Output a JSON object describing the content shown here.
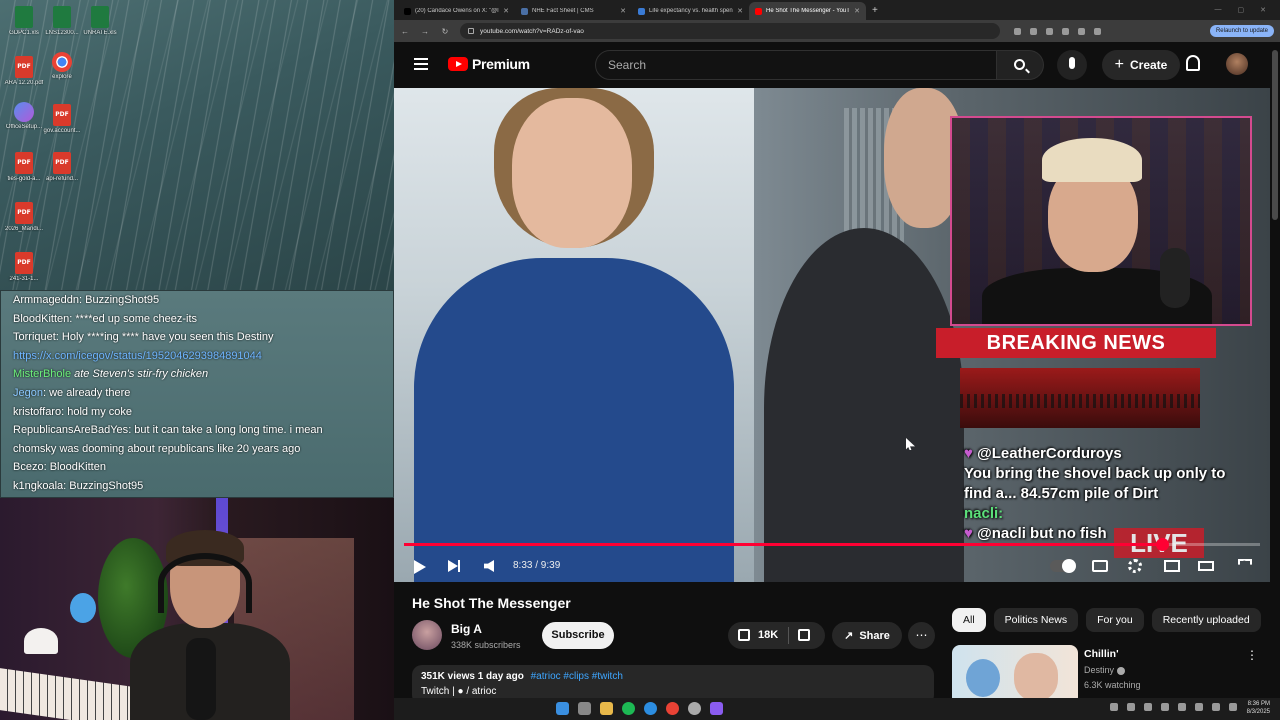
{
  "desktop": {
    "icons": [
      {
        "label": "GDPC1.xls",
        "type": "xls"
      },
      {
        "label": "LNS12300...",
        "type": "xls"
      },
      {
        "label": "UNRATE.xls",
        "type": "xls"
      },
      {
        "label": "ARA 12.20.pdf",
        "type": "pdf"
      },
      {
        "label": "explore",
        "type": "chrome"
      },
      {
        "label": "OfficeSetup...",
        "type": "office"
      },
      {
        "label": "gov.account...",
        "type": "pdf"
      },
      {
        "label": "ties-gold-a...",
        "type": "pdf"
      },
      {
        "label": "api-refund...",
        "type": "pdf"
      },
      {
        "label": "2026_Mandi...",
        "type": "pdf"
      },
      {
        "label": "241-31-1...",
        "type": "pdf"
      }
    ]
  },
  "chat": {
    "lines": [
      {
        "user": "Armmageddn",
        "text": ": BuzzingShot95"
      },
      {
        "user": "BloodKitten",
        "text": ": ****ed up some cheez-its"
      },
      {
        "user": "Torriquet",
        "text": ": Holy ****ing **** have you seen this Destiny"
      },
      {
        "user": "",
        "text": "https://x.com/icegov/status/1952046293984891044"
      },
      {
        "user": "MisterBhole",
        "text": " ate Steven's stir-fry chicken"
      },
      {
        "user": "Jegon",
        "text": ": we already there"
      },
      {
        "user": "kristoffaro",
        "text": ": hold my coke"
      },
      {
        "user": "RepublicansAreBadYes",
        "text": ": but it can take a long long time. i mean"
      },
      {
        "user": "",
        "text": "chomsky was dooming about republicans like 20 years ago"
      },
      {
        "user": "Bcezo",
        "text": ": BloodKitten"
      },
      {
        "user": "k1ngkoala",
        "text": ": BuzzingShot95"
      }
    ]
  },
  "browser": {
    "tabs": [
      {
        "title": "(20) Candace Owens on X: \"@l",
        "color": "#000000"
      },
      {
        "title": "NHE Fact Sheet | CMS",
        "color": "#4a6fa5"
      },
      {
        "title": "Life expectancy vs. health spen",
        "color": "#3a7bd5"
      },
      {
        "title": "He Shot The Messenger - YouT",
        "color": "#ff0000"
      }
    ],
    "url": "youtube.com/watch?v=RADz-of-vao",
    "relaunch_label": "Relaunch to update"
  },
  "youtube": {
    "logo_text": "Premium",
    "search_placeholder": "Search",
    "create_label": "Create",
    "video": {
      "breaking_news": "BREAKING NEWS",
      "overlay_lines": [
        {
          "name": "",
          "text": "@LeatherCorduroys"
        },
        {
          "name": "",
          "text": "You bring the shovel back up only to"
        },
        {
          "name": "",
          "text": "find a... 84.57cm pile of Dirt"
        },
        {
          "name": "nacli:",
          "text": ""
        },
        {
          "name": "",
          "text": "@nacli but no fish"
        }
      ],
      "live_tag": "LIVE",
      "time": "8:33 / 9:39",
      "progress": 0.886
    },
    "title": "He Shot The Messenger",
    "channel": {
      "name": "Big A",
      "subs": "338K subscribers"
    },
    "subscribe_label": "Subscribe",
    "likes": "18K",
    "share_label": "Share",
    "more_label": "⋯",
    "description": {
      "stats": "351K views  1 day ago",
      "tags": "#atrioc #clips #twitch",
      "line2": "Twitch | ● / atrioc"
    },
    "chips": [
      "All",
      "Politics News",
      "For you",
      "Recently uploaded"
    ],
    "recommendation": {
      "title": "Chillin'",
      "channel": "Destiny",
      "watching": "6.3K watching",
      "more": "⋮"
    }
  },
  "taskbar": {
    "time": "8:36 PM",
    "date": "8/3/2025"
  }
}
